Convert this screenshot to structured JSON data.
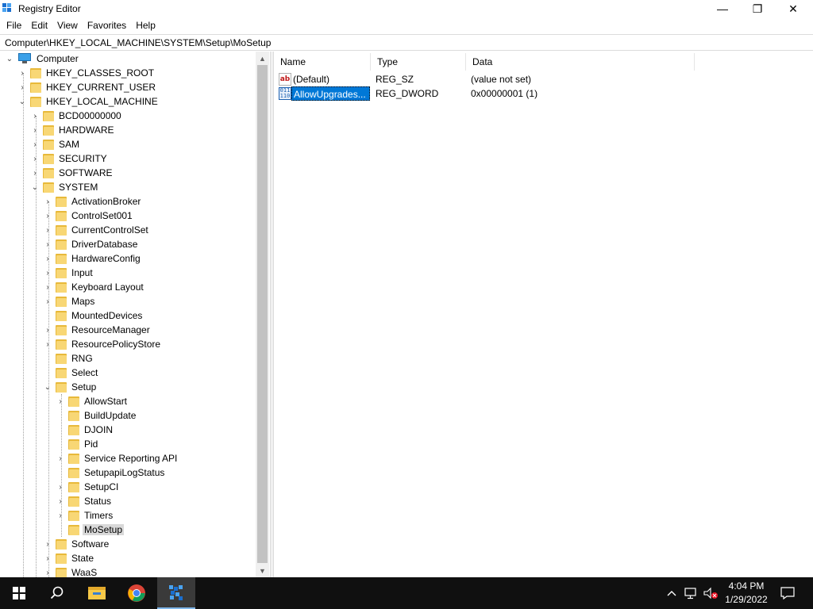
{
  "window": {
    "title": "Registry Editor",
    "controls": {
      "minimize": "—",
      "maximize": "❐",
      "close": "✕"
    }
  },
  "menu": [
    "File",
    "Edit",
    "View",
    "Favorites",
    "Help"
  ],
  "address": "Computer\\HKEY_LOCAL_MACHINE\\SYSTEM\\Setup\\MoSetup",
  "tree": {
    "root": "Computer",
    "hives": {
      "classes_root": "HKEY_CLASSES_ROOT",
      "current_user": "HKEY_CURRENT_USER",
      "local_machine": "HKEY_LOCAL_MACHINE"
    },
    "hklm_children": [
      "BCD00000000",
      "HARDWARE",
      "SAM",
      "SECURITY",
      "SOFTWARE",
      "SYSTEM"
    ],
    "system_children": [
      "ActivationBroker",
      "ControlSet001",
      "CurrentControlSet",
      "DriverDatabase",
      "HardwareConfig",
      "Input",
      "Keyboard Layout",
      "Maps",
      "MountedDevices",
      "ResourceManager",
      "ResourcePolicyStore",
      "RNG",
      "Select",
      "Setup"
    ],
    "setup_children": [
      "AllowStart",
      "BuildUpdate",
      "DJOIN",
      "Pid",
      "Service Reporting API",
      "SetupapiLogStatus",
      "SetupCI",
      "Status",
      "Timers",
      "MoSetup"
    ],
    "after_setup": [
      "Software",
      "State",
      "WaaS"
    ],
    "selected": "MoSetup"
  },
  "list": {
    "columns": [
      "Name",
      "Type",
      "Data"
    ],
    "rows": [
      {
        "name": "(Default)",
        "type": "REG_SZ",
        "data": "(value not set)",
        "icon": "string-value-icon"
      },
      {
        "name": "AllowUpgrades...",
        "type": "REG_DWORD",
        "data": "0x00000001 (1)",
        "icon": "dword-value-icon"
      }
    ]
  },
  "taskbar": {
    "time": "4:04 PM",
    "date": "1/29/2022",
    "apps": [
      "start-icon",
      "search-icon",
      "file-explorer-icon",
      "chrome-icon",
      "registry-editor-icon"
    ]
  },
  "colors": {
    "accent": "#0078d7",
    "folder": "#f8d775",
    "taskbar": "#101010"
  }
}
